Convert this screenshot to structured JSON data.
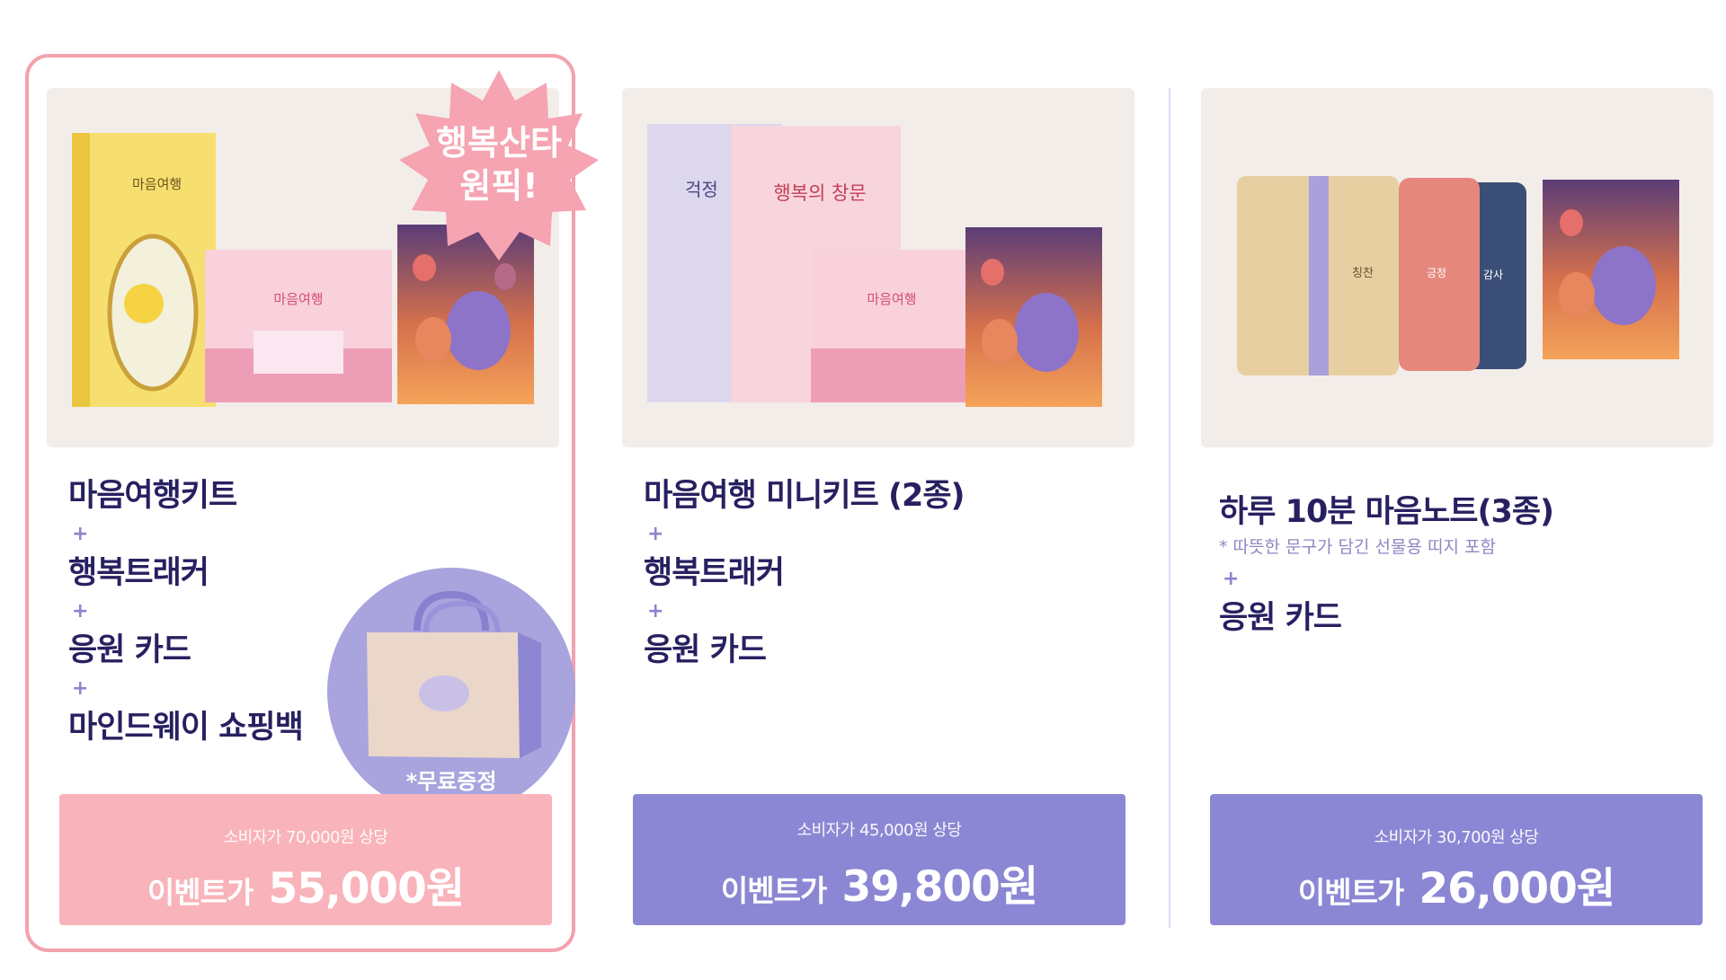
{
  "colors": {
    "pink_accent": "#f9b3ba",
    "purple_accent": "#8c87d4",
    "title_text": "#272060",
    "plus_color": "#8d83cf"
  },
  "card1": {
    "badge_line1": "행복산타",
    "badge_line2": "원픽!",
    "items": [
      "마음여행키트",
      "행복트래커",
      "응원 카드",
      "마인드웨이 쇼핑백"
    ],
    "plus": "+",
    "free_gift": "*무료증정",
    "book_title": "마음여행",
    "price": {
      "consumer": "소비자가 70,000원 상당",
      "event_label": "이벤트가",
      "event_price": "55,000원"
    }
  },
  "card2": {
    "items": [
      "마음여행 미니키트 (2종)",
      "행복트래커",
      "응원 카드"
    ],
    "plus": "+",
    "book1_title": "걱정",
    "book2_title": "행복의 창문",
    "book3_title": "마음여행",
    "price": {
      "consumer": "소비자가 45,000원 상당",
      "event_label": "이벤트가",
      "event_price": "39,800원"
    }
  },
  "card3": {
    "items": [
      "하루 10분 마음노트(3종)",
      "응원 카드"
    ],
    "note": "* 따뜻한 문구가 담긴 선물용 띠지 포함",
    "plus": "+",
    "note1_title": "칭찬",
    "note2_title": "긍정",
    "note3_title": "감사",
    "price": {
      "consumer": "소비자가 30,700원 상당",
      "event_label": "이벤트가",
      "event_price": "26,000원"
    }
  }
}
